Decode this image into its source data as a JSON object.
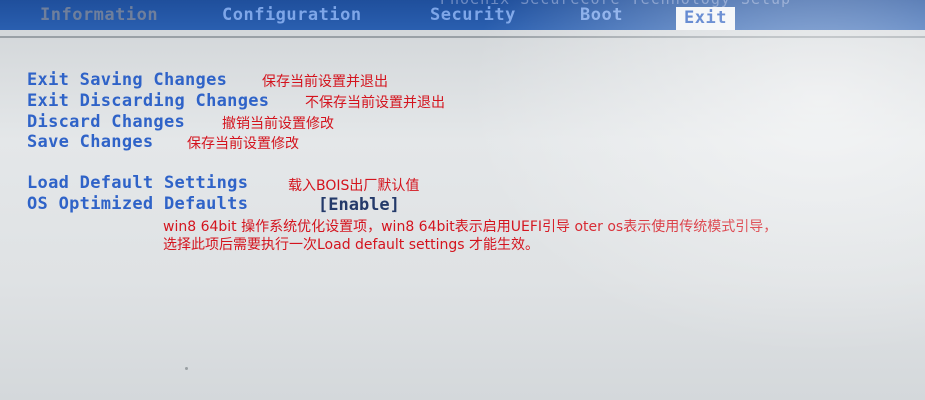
{
  "menu": {
    "background_text": "Phoenix SecureCore Technology Setup",
    "tabs": [
      {
        "label": "Information"
      },
      {
        "label": "Configuration"
      },
      {
        "label": "Security"
      },
      {
        "label": "Boot"
      },
      {
        "label": "Exit",
        "active": true
      }
    ]
  },
  "options": [
    {
      "label": "Exit Saving Changes",
      "note": "保存当前设置并退出"
    },
    {
      "label": "Exit Discarding Changes",
      "note": "不保存当前设置并退出"
    },
    {
      "label": "Discard Changes",
      "note": "撤销当前设置修改"
    },
    {
      "label": "Save Changes",
      "note": "保存当前设置修改"
    },
    {
      "label": "Load Default Settings",
      "note": "载入BOIS出厂默认值"
    },
    {
      "label": "OS Optimized Defaults",
      "value": "[Enable]"
    }
  ],
  "description": {
    "line1": "win8 64bit 操作系统优化设置项，win8 64bit表示启用UEFI引导 oter os表示使用传统模式引导，",
    "line2": "选择此项后需要执行一次Load default settings 才能生效。"
  },
  "colors": {
    "menubar": "#1f4f9c",
    "option_text": "#2f63c8",
    "note_text": "#d4141e",
    "screen_bg": "#dfe2e4"
  }
}
